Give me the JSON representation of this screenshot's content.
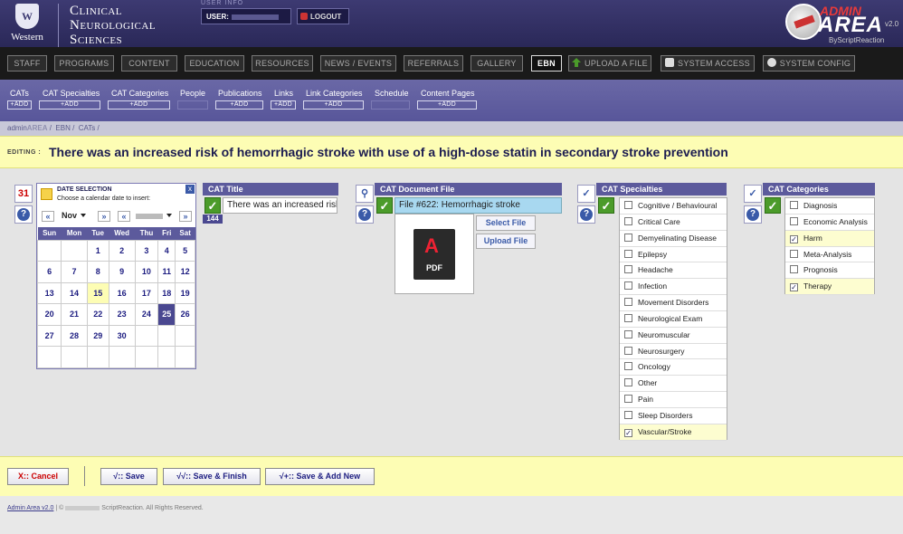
{
  "header": {
    "org_lines": [
      "Clinical",
      "Neurological",
      "Sciences"
    ],
    "university": "Western",
    "crest_glyph": "W",
    "user_info_label": "USER INFO",
    "user_label": "USER:",
    "logout": "LOGOUT",
    "admin_word": "ADMIN",
    "area_word": "AREA",
    "version": "v2.0",
    "by": "ByScriptReaction"
  },
  "topnav": [
    {
      "label": "STAFF"
    },
    {
      "label": "PROGRAMS"
    },
    {
      "label": "CONTENT"
    },
    {
      "label": "EDUCATION"
    },
    {
      "label": "RESOURCES"
    },
    {
      "label": "NEWS / EVENTS"
    },
    {
      "label": "REFERRALS"
    },
    {
      "label": "GALLERY"
    },
    {
      "label": "EBN",
      "active": true
    },
    {
      "label": "UPLOAD A FILE",
      "icon": "upload-arrow-icon"
    },
    {
      "label": "SYSTEM ACCESS",
      "icon": "lock-icon"
    },
    {
      "label": "SYSTEM CONFIG",
      "icon": "gear-icon"
    }
  ],
  "subnav": [
    {
      "label": "CATs",
      "add": "+ADD"
    },
    {
      "label": "CAT Specialties",
      "add": "+ADD"
    },
    {
      "label": "CAT Categories",
      "add": "+ADD"
    },
    {
      "label": "People",
      "add": ""
    },
    {
      "label": "Publications",
      "add": "+ADD"
    },
    {
      "label": "Links",
      "add": "+ADD"
    },
    {
      "label": "Link Categories",
      "add": "+ADD"
    },
    {
      "label": "Schedule",
      "add": ""
    },
    {
      "label": "Content Pages",
      "add": "+ADD"
    }
  ],
  "breadcrumb": {
    "admin": "admin",
    "area": "AREA",
    "sep": "/",
    "items": [
      "EBN",
      "CATs"
    ]
  },
  "editing": {
    "label": "EDITING :",
    "title": "There was an increased risk of hemorrhagic stroke with use of a high-dose statin in secondary stroke prevention"
  },
  "calendar": {
    "icon_text": "31",
    "title": "DATE SELECTION",
    "subtitle": "Choose a calendar date to insert:",
    "close": "x",
    "prev_month": "«",
    "next_month": "»",
    "prev_year": "«",
    "next_year": "»",
    "month": "Nov",
    "days": [
      "Sun",
      "Mon",
      "Tue",
      "Wed",
      "Thu",
      "Fri",
      "Sat"
    ],
    "weeks": [
      [
        "",
        "",
        "1",
        "2",
        "3",
        "4",
        "5"
      ],
      [
        "6",
        "7",
        "8",
        "9",
        "10",
        "11",
        "12"
      ],
      [
        "13",
        "14",
        "15",
        "16",
        "17",
        "18",
        "19"
      ],
      [
        "20",
        "21",
        "22",
        "23",
        "24",
        "25",
        "26"
      ],
      [
        "27",
        "28",
        "29",
        "30",
        "",
        "",
        ""
      ],
      [
        "",
        "",
        "",
        "",
        "",
        "",
        ""
      ]
    ],
    "today": "15",
    "selected": "25"
  },
  "cat_title": {
    "label": "CAT Title",
    "value": "There was an increased risk of hemorrhagic stroke with use of a high-dose statin in secondary stroke prevention",
    "count": "144"
  },
  "doc_file": {
    "label": "CAT Document File",
    "value": "File #622: Hemorrhagic stroke",
    "select": "Select File",
    "upload": "Upload File",
    "pdf": "PDF",
    "pdf_glyph": "A"
  },
  "specialties": {
    "label": "CAT Specialties",
    "items": [
      {
        "label": "Cognitive / Behavioural",
        "checked": false
      },
      {
        "label": "Critical Care",
        "checked": false
      },
      {
        "label": "Demyelinating Disease",
        "checked": false
      },
      {
        "label": "Epilepsy",
        "checked": false
      },
      {
        "label": "Headache",
        "checked": false
      },
      {
        "label": "Infection",
        "checked": false
      },
      {
        "label": "Movement Disorders",
        "checked": false
      },
      {
        "label": "Neurological Exam",
        "checked": false
      },
      {
        "label": "Neuromuscular",
        "checked": false
      },
      {
        "label": "Neurosurgery",
        "checked": false
      },
      {
        "label": "Oncology",
        "checked": false
      },
      {
        "label": "Other",
        "checked": false
      },
      {
        "label": "Pain",
        "checked": false
      },
      {
        "label": "Sleep Disorders",
        "checked": false
      },
      {
        "label": "Vascular/Stroke",
        "checked": true
      }
    ]
  },
  "categories": {
    "label": "CAT Categories",
    "items": [
      {
        "label": "Diagnosis",
        "checked": false
      },
      {
        "label": "Economic Analysis",
        "checked": false
      },
      {
        "label": "Harm",
        "checked": true
      },
      {
        "label": "Meta-Analysis",
        "checked": false
      },
      {
        "label": "Prognosis",
        "checked": false
      },
      {
        "label": "Therapy",
        "checked": true
      }
    ]
  },
  "check_glyph": "✓",
  "help_glyph": "?",
  "actions": {
    "cancel": "X:: Cancel",
    "save": "√:: Save",
    "save_finish": "√√:: Save & Finish",
    "save_new": "√+:: Save & Add New"
  },
  "footer": {
    "link": "Admin Area v2.0",
    "sep": "|",
    "copy_prefix": "©",
    "copy_suffix": "ScriptReaction. All Rights Reserved."
  },
  "colors": {
    "header": "#3d3a72",
    "subnav": "#5c5a9c",
    "highlight": "#fdfdb4",
    "check_green": "#4b9b2a"
  }
}
